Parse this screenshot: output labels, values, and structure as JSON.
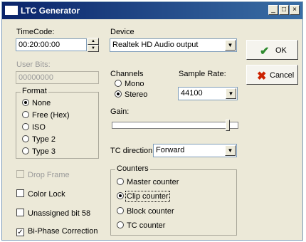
{
  "window": {
    "title": "LTC Generator",
    "minimize_glyph": "_",
    "maximize_glyph": "□",
    "close_glyph": "×"
  },
  "timecode": {
    "label": "TimeCode:",
    "value": "00:20:00:00"
  },
  "user_bits": {
    "label": "User Bits:",
    "value": "00000000"
  },
  "format": {
    "title": "Format",
    "options": [
      "None",
      "Free (Hex)",
      "ISO",
      "Type 2",
      "Type 3"
    ],
    "selected": "None"
  },
  "checkboxes": {
    "drop_frame": {
      "label": "Drop Frame",
      "checked": false,
      "enabled": false
    },
    "color_lock": {
      "label": "Color Lock",
      "checked": false,
      "enabled": true
    },
    "unassigned_bit": {
      "label": "Unassigned bit 58",
      "checked": false,
      "enabled": true
    },
    "biphase": {
      "label": "Bi-Phase Correction",
      "checked": true,
      "enabled": true
    }
  },
  "device": {
    "label": "Device",
    "value": "Realtek HD Audio output"
  },
  "channels": {
    "title": "Channels",
    "options": [
      "Mono",
      "Stereo"
    ],
    "selected": "Stereo"
  },
  "sample_rate": {
    "label": "Sample Rate:",
    "value": "44100"
  },
  "gain": {
    "label": "Gain:",
    "level": 0.93
  },
  "tc_direction": {
    "label": "TC direction",
    "value": "Forward"
  },
  "counters": {
    "title": "Counters",
    "options": [
      "Master counter",
      "Clip counter",
      "Block counter",
      "TC counter"
    ],
    "selected": "Clip counter"
  },
  "buttons": {
    "ok": {
      "label": "OK",
      "icon": "checkmark-icon",
      "color": "#2e8b2e"
    },
    "cancel": {
      "label": "Cancel",
      "icon": "red-x-icon",
      "color": "#cc2200"
    }
  }
}
